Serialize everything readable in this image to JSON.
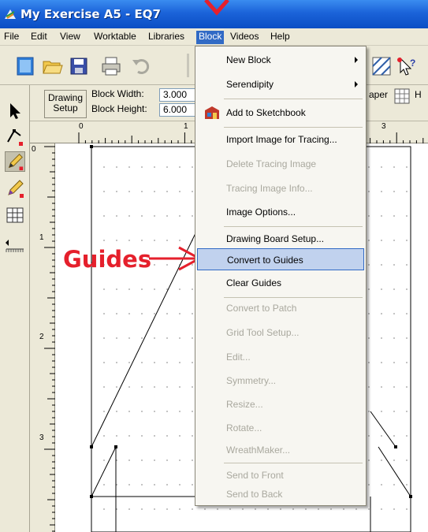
{
  "window": {
    "title": "My Exercise A5 - EQ7"
  },
  "menubar": {
    "items": [
      "File",
      "Edit",
      "View",
      "Worktable",
      "Libraries",
      "Block",
      "Videos",
      "Help"
    ],
    "active": "Block"
  },
  "propbar": {
    "drawing_setup": "Drawing Setup",
    "block_width_label": "Block Width:",
    "block_width_value": "3.000",
    "block_height_label": "Block Height:",
    "block_height_value": "6.000",
    "paper_label": "aper",
    "extra_label": "H"
  },
  "ruler": {
    "h_labels": [
      "0",
      "1",
      "3"
    ],
    "v_labels": [
      "0",
      "1",
      "2",
      "3"
    ]
  },
  "block_menu": {
    "items": [
      {
        "label": "New Block",
        "enabled": true,
        "submenu": true
      },
      {
        "label": "Serendipity",
        "enabled": true,
        "submenu": true
      },
      {
        "label": "Add to Sketchbook",
        "enabled": true,
        "icon": "sketchbook-icon"
      },
      {
        "label": "Import Image for Tracing...",
        "enabled": true
      },
      {
        "label": "Delete Tracing Image",
        "enabled": false
      },
      {
        "label": "Tracing Image Info...",
        "enabled": false
      },
      {
        "label": "Image Options...",
        "enabled": true
      },
      {
        "label": "Drawing Board Setup...",
        "enabled": true
      },
      {
        "label": "Convert to Guides",
        "enabled": true,
        "highlighted": true
      },
      {
        "label": "Clear Guides",
        "enabled": true
      },
      {
        "label": "Convert to Patch",
        "enabled": false
      },
      {
        "label": "Grid Tool Setup...",
        "enabled": false
      },
      {
        "label": "Edit...",
        "enabled": false
      },
      {
        "label": "Symmetry...",
        "enabled": false
      },
      {
        "label": "Resize...",
        "enabled": false
      },
      {
        "label": "Rotate...",
        "enabled": false
      },
      {
        "label": "WreathMaker...",
        "enabled": false
      },
      {
        "label": "Send to Front",
        "enabled": false
      },
      {
        "label": "Send to Back",
        "enabled": false
      }
    ]
  },
  "annotation": {
    "label": "Guides",
    "color": "#e5202c"
  },
  "colors": {
    "titlebar": "#1b63d9",
    "menu_highlight": "#316ac5",
    "item_highlight": "#c1d2ee",
    "chrome": "#ece9d8"
  }
}
